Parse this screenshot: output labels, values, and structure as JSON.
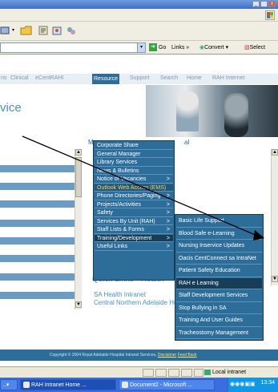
{
  "window": {
    "min": "_",
    "max": " ",
    "close": "x"
  },
  "addressbar": {
    "go_label": "Go",
    "links_label": "Links",
    "convert_label": "Convert",
    "select_label": "Select"
  },
  "nav": {
    "items": [
      "ns",
      "Clinical",
      "eCentRAHI",
      "Resource",
      "Support",
      "Search",
      "Home",
      "RAH Internet"
    ],
    "active_index": 3
  },
  "page": {
    "title": "vice",
    "partial_left": "M",
    "partial_right": "al"
  },
  "resource_menu": [
    {
      "label": "Corporate Share",
      "arrow": ""
    },
    {
      "label": "General Manager",
      "arrow": ""
    },
    {
      "label": "Library Services",
      "arrow": ""
    },
    {
      "label": "News & Bulletins",
      "arrow": ""
    },
    {
      "label": "Notice of Vacancies",
      "arrow": ">"
    },
    {
      "label": "Outlook Web Access (EMS)",
      "arrow": "",
      "highlight": true
    },
    {
      "label": "Phone Directories/Paging",
      "arrow": ">"
    },
    {
      "label": "Projects/Activities",
      "arrow": ">"
    },
    {
      "label": "Safety",
      "arrow": ">"
    },
    {
      "label": "Services By Unit (RAH)",
      "arrow": ">"
    },
    {
      "label": "Staff Lists & Forms",
      "arrow": ">"
    },
    {
      "label": "Training/Development",
      "arrow": ">",
      "selected": true
    },
    {
      "label": "Useful Links",
      "arrow": ">"
    }
  ],
  "training_menu": [
    {
      "label": "Basic Life Support"
    },
    {
      "label": "Blood Safe e-Learning"
    },
    {
      "label": "Nursing Inservice Updates"
    },
    {
      "label": "Oacis CentConnect sa IntraNet"
    },
    {
      "label": "Patient Safety Education"
    },
    {
      "label": "RAH e Learning",
      "selected": true
    },
    {
      "label": "Staff Development Services"
    },
    {
      "label": "Stop Bullying in SA"
    },
    {
      "label": "Training And User Guides"
    },
    {
      "label": "Tracheostomy Management"
    }
  ],
  "quicklinks": {
    "title": "Quick Links - Health",
    "items": [
      "SA Health Intranet",
      "Central Northern Adelaide Health Service"
    ]
  },
  "footer": {
    "text": "Copyright © 2004 Royal Adelaide Hospital Intranet Services,",
    "disclaimer": "Disclaimer",
    "feedback": "Feed Back"
  },
  "status": {
    "zone": "Local intranet"
  },
  "taskbar": {
    "buttons": [
      "RAH Intranet Home ...",
      "Document2 - Microsoft ..."
    ],
    "clock": "13:34"
  },
  "colors": {
    "accent": "#2c6d9a",
    "title": "#4b93c4",
    "highlight_text": "#ffd24a"
  }
}
